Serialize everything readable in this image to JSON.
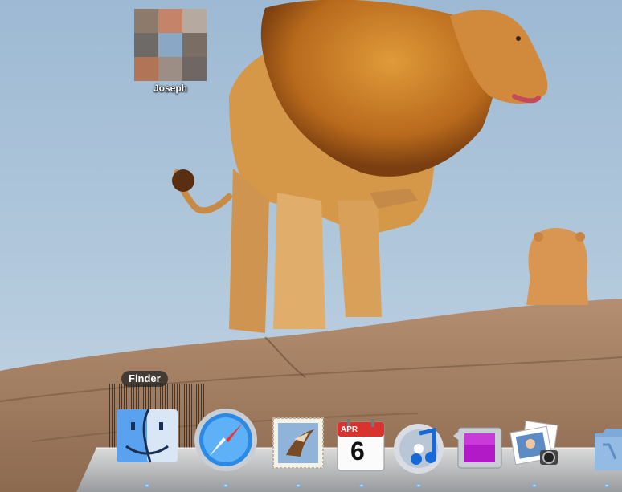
{
  "desktop": {
    "icon_label": "Joseph"
  },
  "dock": {
    "tooltip": "Finder",
    "apps": [
      {
        "icon": "finder-icon"
      },
      {
        "icon": "safari-icon"
      },
      {
        "icon": "mail-icon"
      },
      {
        "icon": "ical-icon",
        "month": "APR",
        "day": "6"
      },
      {
        "icon": "itunes-icon"
      },
      {
        "icon": "front-row-icon"
      },
      {
        "icon": "iphoto-icon"
      },
      {
        "icon": "applications-folder-icon"
      }
    ]
  },
  "colors": {
    "sky": "#b9cfe0",
    "rock": "#a67d5e",
    "lion_mane": "#c47822",
    "lion_body": "#d9a05a"
  }
}
